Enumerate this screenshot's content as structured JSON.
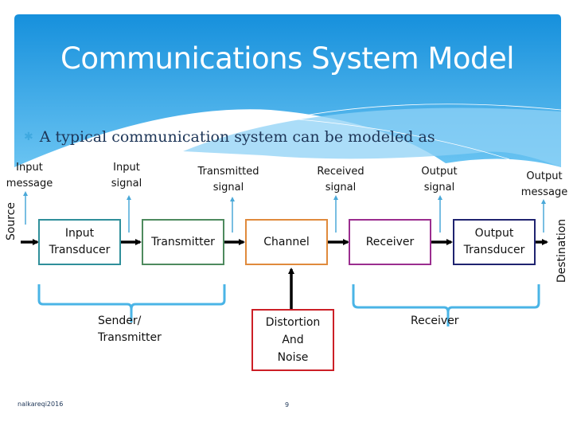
{
  "slide": {
    "title": "Communications System Model",
    "bullet": "A typical communication system can be modeled as",
    "bullet_icon": "asterisk-bullet-icon",
    "footer_left": "nalkareqi2016",
    "page_number": "9"
  },
  "colors": {
    "header_blue": "#1e9be0",
    "header_light": "#5bbdf0",
    "signal_arrow": "#4aa8d8",
    "brace": "#4ab4e6",
    "input_transducer": "#2f8f9a",
    "transmitter": "#4e8a5e",
    "channel": "#e08a3c",
    "receiver": "#9b2d8f",
    "output_transducer": "#1f2370",
    "noise": "#cc1f26"
  },
  "endpoints": {
    "source": "Source",
    "destination": "Destination"
  },
  "signal_labels": [
    {
      "id": "input-message",
      "text": "Input\nmessage"
    },
    {
      "id": "input-signal",
      "text": "Input\nsignal"
    },
    {
      "id": "transmitted-signal",
      "text": "Transmitted\nsignal"
    },
    {
      "id": "received-signal",
      "text": "Received\nsignal"
    },
    {
      "id": "output-signal",
      "text": "Output\nsignal"
    },
    {
      "id": "output-message",
      "text": "Output\nmessage"
    }
  ],
  "blocks": [
    {
      "id": "input-transducer",
      "text": "Input\nTransducer"
    },
    {
      "id": "transmitter",
      "text": "Transmitter"
    },
    {
      "id": "channel",
      "text": "Channel"
    },
    {
      "id": "receiver",
      "text": "Receiver"
    },
    {
      "id": "output-transducer",
      "text": "Output\nTransducer"
    }
  ],
  "noise_block": {
    "text": "Distortion\nAnd\nNoise"
  },
  "groups": [
    {
      "id": "sender-group",
      "text": "Sender/\nTransmitter"
    },
    {
      "id": "receiver-group",
      "text": "Receiver"
    }
  ]
}
